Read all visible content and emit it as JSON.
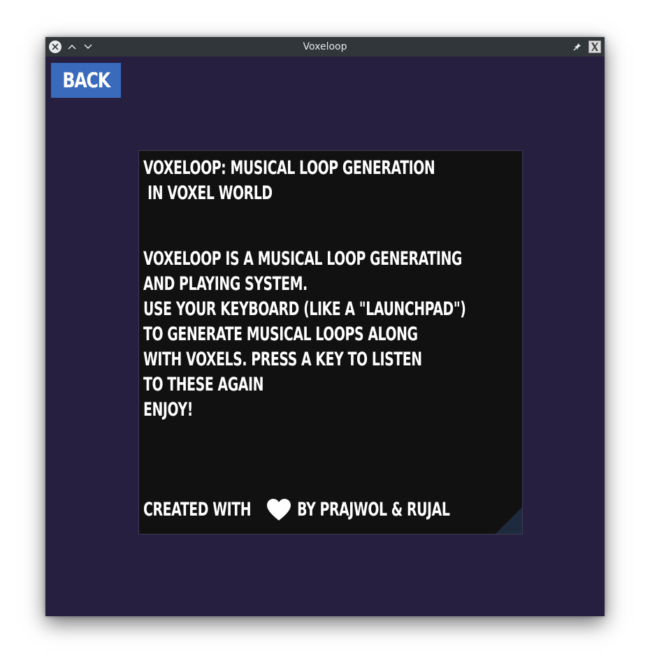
{
  "window": {
    "title": "Voxeloop"
  },
  "nav": {
    "back_label": "BACK"
  },
  "about": {
    "title_lines": [
      "VOXELOOP: MUSICAL LOOP GENERATION",
      " IN VOXEL WORLD"
    ],
    "description_lines": [
      "VOXELOOP IS A MUSICAL LOOP GENERATING",
      "AND PLAYING SYSTEM.",
      "USE YOUR KEYBOARD (LIKE A \"LAUNCHPAD\")",
      "TO GENERATE MUSICAL LOOPS ALONG",
      "WITH VOXELS. PRESS A KEY TO LISTEN",
      "TO THESE AGAIN",
      "ENJOY!"
    ],
    "credit_prefix": "CREATED WITH ",
    "credit_icon": "heart-icon",
    "credit_suffix": " BY PRAJWOL & RUJAL"
  },
  "colors": {
    "window_background": "#261f40",
    "titlebar": "#31363b",
    "back_button": "#3a6abb",
    "panel_background": "#111111",
    "text": "#ffffff"
  }
}
